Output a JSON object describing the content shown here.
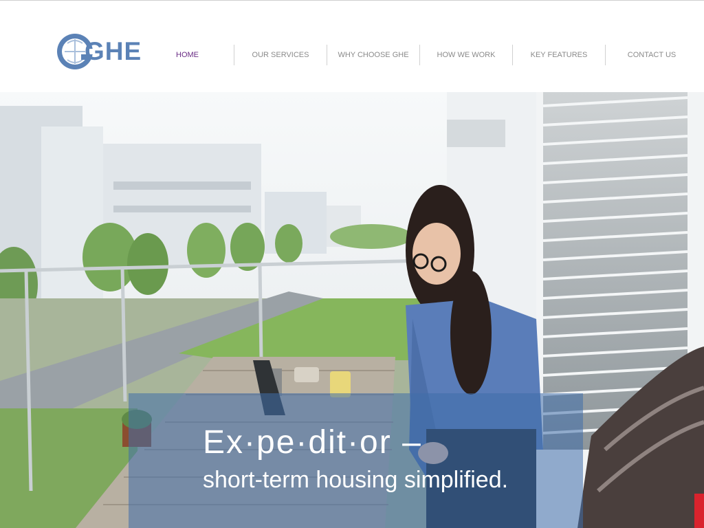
{
  "brand": {
    "logo_text": "GHE",
    "colors": {
      "logo_blue": "#5b82b6",
      "logo_orange": "#f3a21b",
      "active_nav": "#6a2c85",
      "nav_text": "#8a8a8a",
      "caption_overlay": "#406eaa",
      "accent_red": "#d9232d"
    }
  },
  "nav": {
    "items": [
      {
        "label": "HOME",
        "active": true
      },
      {
        "label": "OUR SERVICES"
      },
      {
        "label": "WHY CHOOSE GHE"
      },
      {
        "label": "HOW WE WORK"
      },
      {
        "label": "KEY FEATURES"
      },
      {
        "label": "CONTACT US"
      }
    ]
  },
  "hero": {
    "title": "Ex·pe·dit·or –",
    "subtitle": "short-term housing simplified."
  }
}
